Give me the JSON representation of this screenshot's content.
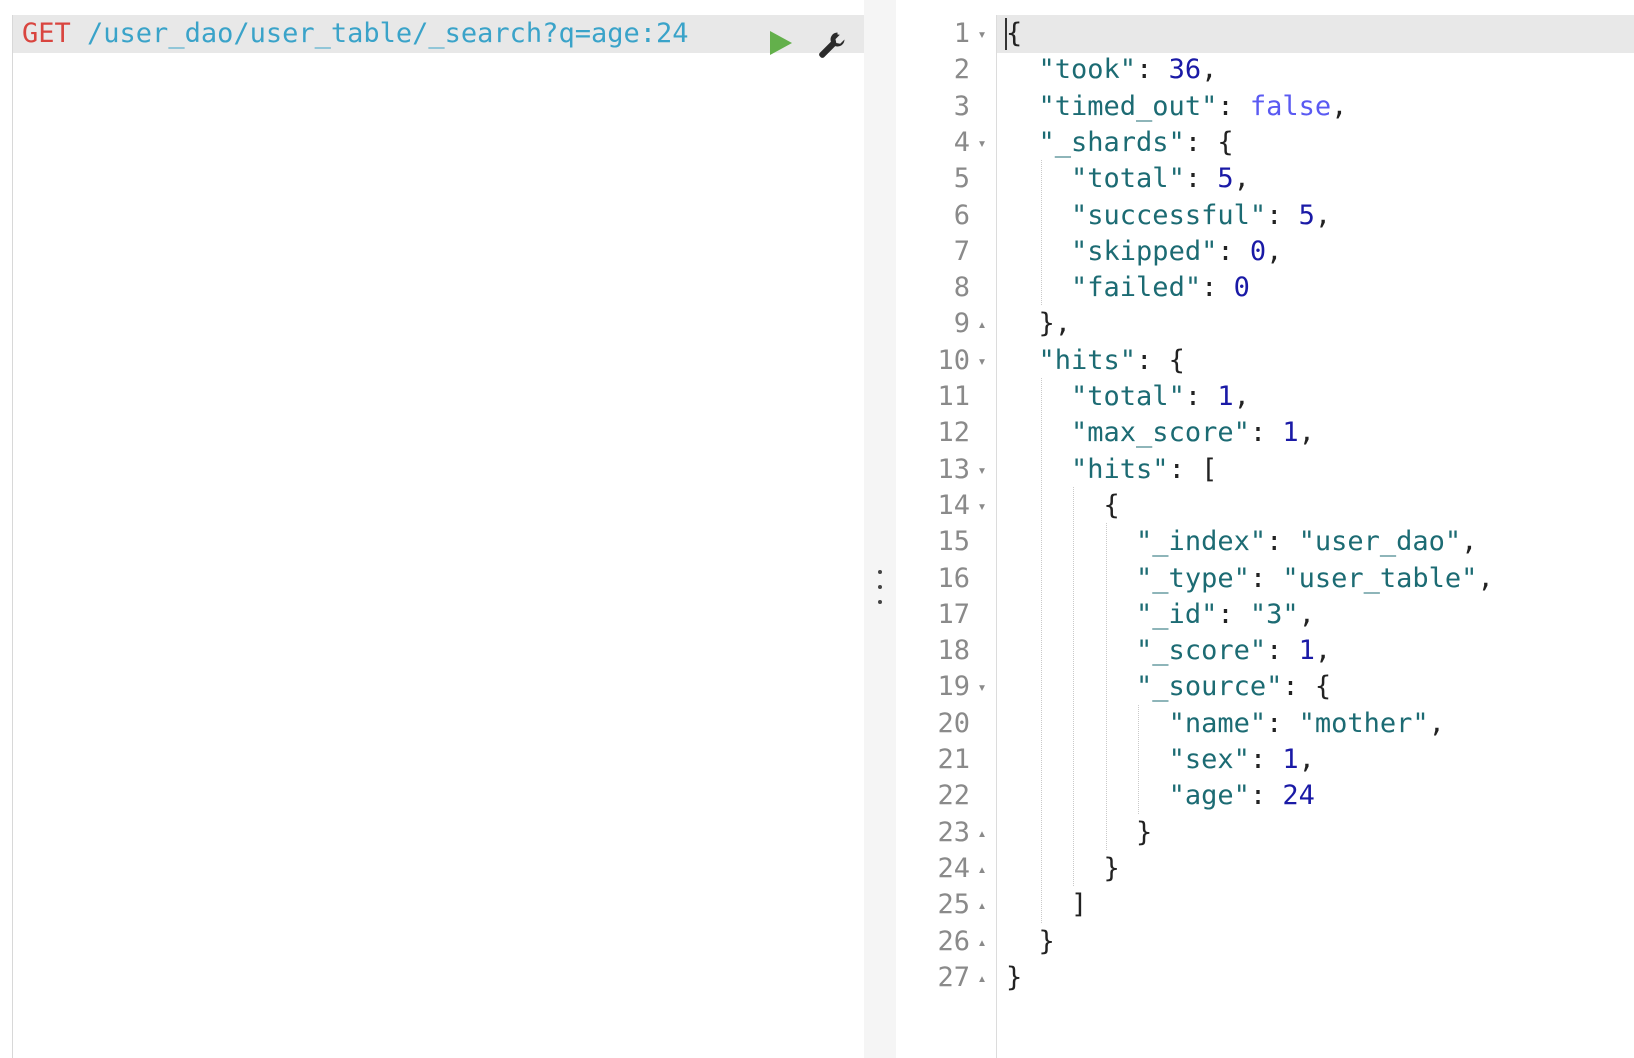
{
  "request": {
    "method": "GET",
    "url": " /user_dao/user_table/_search?q=age:24"
  },
  "toolbar": {
    "run_icon": "play-icon",
    "settings_icon": "wrench-icon",
    "run_color": "#63b04b"
  },
  "response": {
    "lines": [
      {
        "n": "1",
        "fold": "▾",
        "parts": [
          [
            "punc",
            "{"
          ]
        ]
      },
      {
        "n": "2",
        "fold": "",
        "parts": [
          [
            "punc",
            "  "
          ],
          [
            "key",
            "\"took\""
          ],
          [
            "punc",
            ": "
          ],
          [
            "num",
            "36"
          ],
          [
            "punc",
            ","
          ]
        ]
      },
      {
        "n": "3",
        "fold": "",
        "parts": [
          [
            "punc",
            "  "
          ],
          [
            "key",
            "\"timed_out\""
          ],
          [
            "punc",
            ": "
          ],
          [
            "bool",
            "false"
          ],
          [
            "punc",
            ","
          ]
        ]
      },
      {
        "n": "4",
        "fold": "▾",
        "parts": [
          [
            "punc",
            "  "
          ],
          [
            "key",
            "\"_shards\""
          ],
          [
            "punc",
            ": {"
          ]
        ]
      },
      {
        "n": "5",
        "fold": "",
        "parts": [
          [
            "punc",
            "    "
          ],
          [
            "key",
            "\"total\""
          ],
          [
            "punc",
            ": "
          ],
          [
            "num",
            "5"
          ],
          [
            "punc",
            ","
          ]
        ]
      },
      {
        "n": "6",
        "fold": "",
        "parts": [
          [
            "punc",
            "    "
          ],
          [
            "key",
            "\"successful\""
          ],
          [
            "punc",
            ": "
          ],
          [
            "num",
            "5"
          ],
          [
            "punc",
            ","
          ]
        ]
      },
      {
        "n": "7",
        "fold": "",
        "parts": [
          [
            "punc",
            "    "
          ],
          [
            "key",
            "\"skipped\""
          ],
          [
            "punc",
            ": "
          ],
          [
            "num",
            "0"
          ],
          [
            "punc",
            ","
          ]
        ]
      },
      {
        "n": "8",
        "fold": "",
        "parts": [
          [
            "punc",
            "    "
          ],
          [
            "key",
            "\"failed\""
          ],
          [
            "punc",
            ": "
          ],
          [
            "num",
            "0"
          ]
        ]
      },
      {
        "n": "9",
        "fold": "▴",
        "parts": [
          [
            "punc",
            "  },"
          ]
        ]
      },
      {
        "n": "10",
        "fold": "▾",
        "parts": [
          [
            "punc",
            "  "
          ],
          [
            "key",
            "\"hits\""
          ],
          [
            "punc",
            ": {"
          ]
        ]
      },
      {
        "n": "11",
        "fold": "",
        "parts": [
          [
            "punc",
            "    "
          ],
          [
            "key",
            "\"total\""
          ],
          [
            "punc",
            ": "
          ],
          [
            "num",
            "1"
          ],
          [
            "punc",
            ","
          ]
        ]
      },
      {
        "n": "12",
        "fold": "",
        "parts": [
          [
            "punc",
            "    "
          ],
          [
            "key",
            "\"max_score\""
          ],
          [
            "punc",
            ": "
          ],
          [
            "num",
            "1"
          ],
          [
            "punc",
            ","
          ]
        ]
      },
      {
        "n": "13",
        "fold": "▾",
        "parts": [
          [
            "punc",
            "    "
          ],
          [
            "key",
            "\"hits\""
          ],
          [
            "punc",
            ": ["
          ]
        ]
      },
      {
        "n": "14",
        "fold": "▾",
        "parts": [
          [
            "punc",
            "      {"
          ]
        ]
      },
      {
        "n": "15",
        "fold": "",
        "parts": [
          [
            "punc",
            "        "
          ],
          [
            "key",
            "\"_index\""
          ],
          [
            "punc",
            ": "
          ],
          [
            "str",
            "\"user_dao\""
          ],
          [
            "punc",
            ","
          ]
        ]
      },
      {
        "n": "16",
        "fold": "",
        "parts": [
          [
            "punc",
            "        "
          ],
          [
            "key",
            "\"_type\""
          ],
          [
            "punc",
            ": "
          ],
          [
            "str",
            "\"user_table\""
          ],
          [
            "punc",
            ","
          ]
        ]
      },
      {
        "n": "17",
        "fold": "",
        "parts": [
          [
            "punc",
            "        "
          ],
          [
            "key",
            "\"_id\""
          ],
          [
            "punc",
            ": "
          ],
          [
            "str",
            "\"3\""
          ],
          [
            "punc",
            ","
          ]
        ]
      },
      {
        "n": "18",
        "fold": "",
        "parts": [
          [
            "punc",
            "        "
          ],
          [
            "key",
            "\"_score\""
          ],
          [
            "punc",
            ": "
          ],
          [
            "num",
            "1"
          ],
          [
            "punc",
            ","
          ]
        ]
      },
      {
        "n": "19",
        "fold": "▾",
        "parts": [
          [
            "punc",
            "        "
          ],
          [
            "key",
            "\"_source\""
          ],
          [
            "punc",
            ": {"
          ]
        ]
      },
      {
        "n": "20",
        "fold": "",
        "parts": [
          [
            "punc",
            "          "
          ],
          [
            "key",
            "\"name\""
          ],
          [
            "punc",
            ": "
          ],
          [
            "str",
            "\"mother\""
          ],
          [
            "punc",
            ","
          ]
        ]
      },
      {
        "n": "21",
        "fold": "",
        "parts": [
          [
            "punc",
            "          "
          ],
          [
            "key",
            "\"sex\""
          ],
          [
            "punc",
            ": "
          ],
          [
            "num",
            "1"
          ],
          [
            "punc",
            ","
          ]
        ]
      },
      {
        "n": "22",
        "fold": "",
        "parts": [
          [
            "punc",
            "          "
          ],
          [
            "key",
            "\"age\""
          ],
          [
            "punc",
            ": "
          ],
          [
            "num",
            "24"
          ]
        ]
      },
      {
        "n": "23",
        "fold": "▴",
        "parts": [
          [
            "punc",
            "        }"
          ]
        ]
      },
      {
        "n": "24",
        "fold": "▴",
        "parts": [
          [
            "punc",
            "      }"
          ]
        ]
      },
      {
        "n": "25",
        "fold": "▴",
        "parts": [
          [
            "punc",
            "    ]"
          ]
        ]
      },
      {
        "n": "26",
        "fold": "▴",
        "parts": [
          [
            "punc",
            "  }"
          ]
        ]
      },
      {
        "n": "27",
        "fold": "▴",
        "parts": [
          [
            "punc",
            "}"
          ]
        ]
      }
    ]
  }
}
